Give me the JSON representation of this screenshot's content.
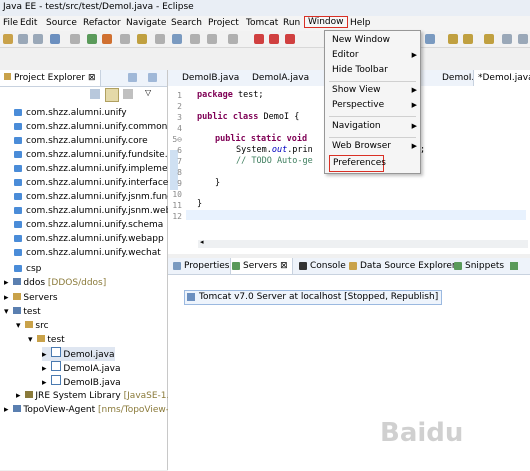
{
  "window": {
    "title": "Java EE - test/src/test/DemoI.java - Eclipse"
  },
  "menubar": {
    "items": [
      "File",
      "Edit",
      "Source",
      "Refactor",
      "Navigate",
      "Search",
      "Project",
      "Tomcat",
      "Run",
      "Window",
      "Help"
    ]
  },
  "window_menu": {
    "items": [
      {
        "label": "New Window",
        "submenu": false
      },
      {
        "label": "Editor",
        "submenu": true
      },
      {
        "label": "Hide Toolbar",
        "submenu": false
      },
      {
        "label": "Show View",
        "submenu": true
      },
      {
        "label": "Perspective",
        "submenu": true
      },
      {
        "label": "Navigation",
        "submenu": true
      },
      {
        "label": "Web Browser",
        "submenu": true
      },
      {
        "label": "Preferences",
        "submenu": false
      }
    ]
  },
  "project_explorer": {
    "tab_label": "Project Explorer",
    "packages": [
      "com.shzz.alumni.unify",
      "com.shzz.alumni.unify.common",
      "com.shzz.alumni.unify.core",
      "com.shzz.alumni.unify.fundsite.web",
      "com.shzz.alumni.unify.implement",
      "com.shzz.alumni.unify.interfaces",
      "com.shzz.alumni.unify.jsnm.fundsite",
      "com.shzz.alumni.unify.jsnm.website",
      "com.shzz.alumni.unify.schema",
      "com.shzz.alumni.unify.webapp",
      "com.shzz.alumni.unify.wechat",
      "csp"
    ],
    "ddos": {
      "label": "ddos",
      "suffix": "[DDOS/ddos]"
    },
    "servers": "Servers",
    "test": "test",
    "src": "src",
    "pkg_test": "test",
    "files": [
      "DemoI.java",
      "DemoIA.java",
      "DemoIB.java"
    ],
    "jre": {
      "label": "JRE System Library",
      "suffix": "[JavaSE-1.8"
    },
    "topoview": {
      "label": "TopoView-Agent",
      "suffix": "[nms/TopoView-"
    }
  },
  "editor": {
    "tabs": [
      "DemoIB.java",
      "DemoIA.java",
      "DemoI.java",
      "*DemoI.java"
    ],
    "line_numbers": [
      "1",
      "2",
      "3",
      "4",
      "5⊖",
      "6",
      "7",
      "8",
      "9",
      "10",
      "11",
      "12"
    ],
    "code": {
      "line1_kw": "package",
      "line1_rest": " test;",
      "line3_kw": "public class",
      "line3_rest": " DemoI {",
      "line5_kw": "public static void",
      "line5_rest": "",
      "line6_a": "System.",
      "line6_fld": "out",
      "line6_b": ".prin",
      "line6_end": ";",
      "line7_cm": "// TODO Auto-ge",
      "line9": "}",
      "line11": "}"
    }
  },
  "bottom_panel": {
    "tabs": [
      "Properties",
      "Servers",
      "Console",
      "Data Source Explorer",
      "Snippets"
    ],
    "server_entry": "Tomcat v7.0 Server at localhost  [Stopped, Republish]"
  },
  "watermark": "Baidu",
  "colors": {
    "highlight_box": "#d93025",
    "package_icon": "#4a8cd8"
  }
}
